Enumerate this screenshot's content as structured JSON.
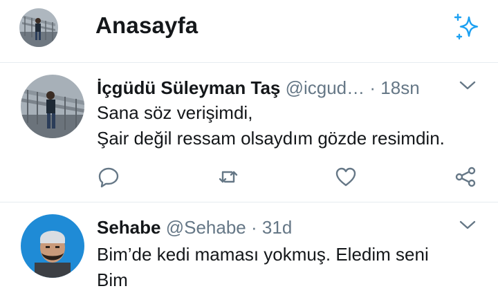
{
  "header": {
    "title": "Anasayfa"
  },
  "tweets": [
    {
      "name": "İçgüdü Süleyman Taş",
      "handle": "@icgud…",
      "dot": "·",
      "time": "18sn",
      "lines": [
        "Sana söz verişimdi,",
        "Şair değil ressam olsaydım gözde resimdin."
      ]
    },
    {
      "name": "Sehabe",
      "handle": "@Sehabe",
      "dot": "·",
      "time": "31d",
      "lines": [
        "Bim’de kedi maması yokmuş. Eledim seni",
        "Bim"
      ]
    }
  ],
  "icons": {
    "sparkle": "sparkle-icon",
    "chevron": "chevron-down-icon",
    "reply": "reply-icon",
    "retweet": "retweet-icon",
    "like": "heart-icon",
    "share": "share-icon"
  },
  "colors": {
    "accent": "#1da1f2",
    "muted": "#657786",
    "divider": "#e6ecf0"
  }
}
